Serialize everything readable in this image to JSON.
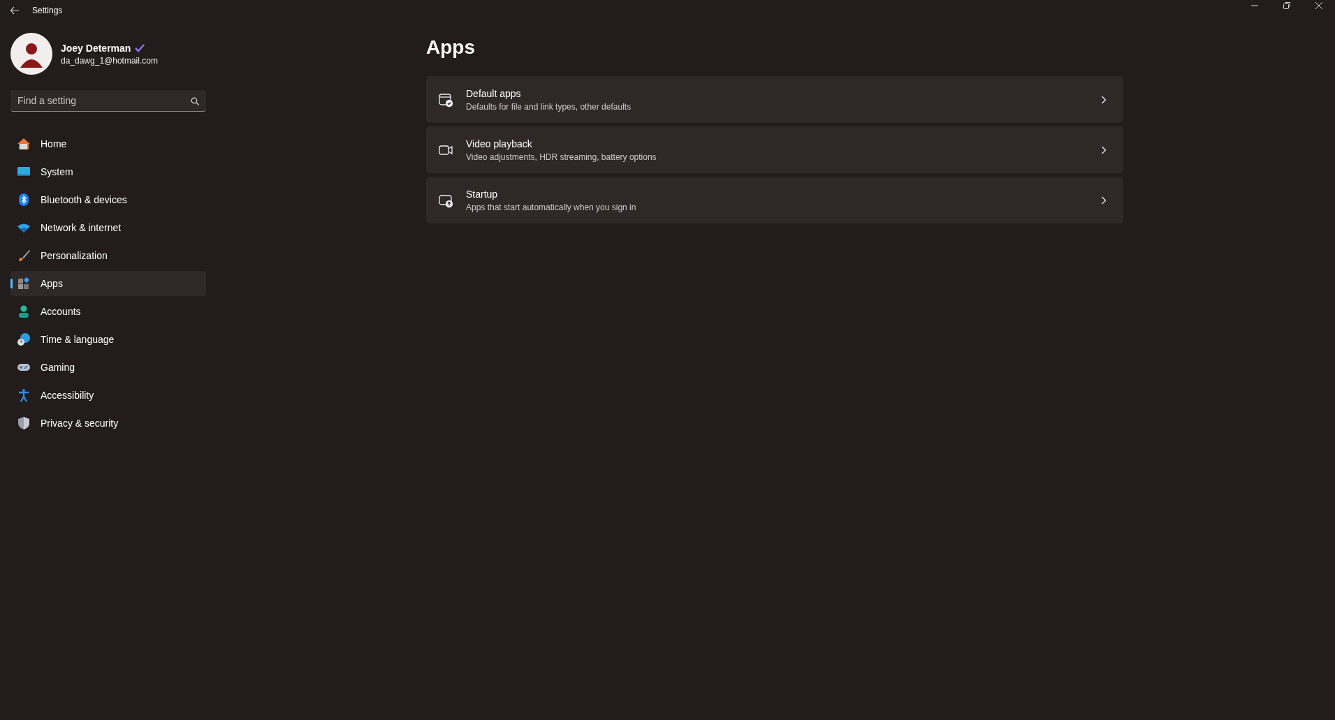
{
  "window": {
    "title": "Settings"
  },
  "user": {
    "name": "Joey Determan",
    "email": "da_dawg_1@hotmail.com",
    "verified": true
  },
  "search": {
    "placeholder": "Find a setting"
  },
  "nav": [
    {
      "label": "Home",
      "kind": "home",
      "selected": false
    },
    {
      "label": "System",
      "kind": "system",
      "selected": false
    },
    {
      "label": "Bluetooth & devices",
      "kind": "bluetooth",
      "selected": false
    },
    {
      "label": "Network & internet",
      "kind": "network",
      "selected": false
    },
    {
      "label": "Personalization",
      "kind": "brush",
      "selected": false
    },
    {
      "label": "Apps",
      "kind": "apps",
      "selected": true
    },
    {
      "label": "Accounts",
      "kind": "accounts",
      "selected": false
    },
    {
      "label": "Time & language",
      "kind": "time",
      "selected": false
    },
    {
      "label": "Gaming",
      "kind": "gaming",
      "selected": false
    },
    {
      "label": "Accessibility",
      "kind": "accessibility",
      "selected": false
    },
    {
      "label": "Privacy & security",
      "kind": "privacy",
      "selected": false
    }
  ],
  "page": {
    "title": "Apps"
  },
  "cards": [
    {
      "title": "Default apps",
      "subtitle": "Defaults for file and link types, other defaults",
      "kind": "defaults"
    },
    {
      "title": "Video playback",
      "subtitle": "Video adjustments, HDR streaming, battery options",
      "kind": "video"
    },
    {
      "title": "Startup",
      "subtitle": "Apps that start automatically when you sign in",
      "kind": "startup"
    }
  ]
}
